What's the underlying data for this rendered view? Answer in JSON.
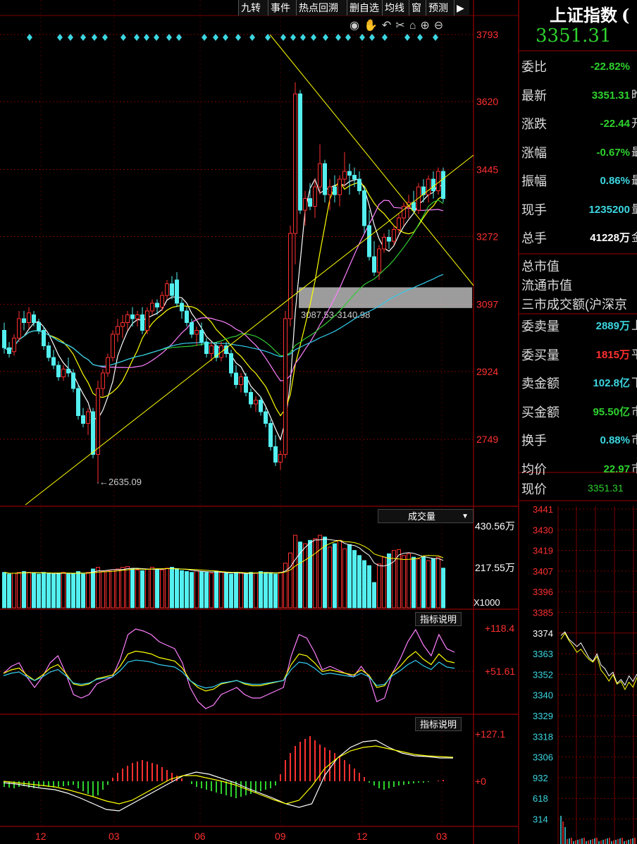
{
  "toolbar": {
    "buttons": [
      "九转",
      "事件",
      "热点回溯",
      "删自选",
      "均线",
      "窗",
      "预测"
    ]
  },
  "main_chart": {
    "y_ticks": [
      "3793",
      "3620",
      "3445",
      "3272",
      "3097",
      "2924",
      "2749"
    ],
    "low_annotation": "2635.09",
    "zone_annotation": "3087.53-3140.98",
    "x_ticks": [
      "12",
      "03",
      "06",
      "09",
      "12",
      "03"
    ]
  },
  "volume_panel": {
    "selector_label": "成交量",
    "ticks": [
      "430.56万",
      "217.55万"
    ],
    "unit": "X1000"
  },
  "indicator_1": {
    "label": "指标说明",
    "ticks": [
      "+118.4",
      "+51.61"
    ]
  },
  "indicator_2": {
    "label": "指标说明",
    "ticks": [
      "+127.1",
      "+0"
    ]
  },
  "quote": {
    "title": "上证指数",
    "title_tail": "(",
    "price": "3351.31",
    "rows": [
      {
        "label": "委比",
        "value": "-22.82%",
        "color": "green",
        "tail": ""
      },
      {
        "label": "最新",
        "value": "3351.31",
        "color": "green",
        "tail": "昨"
      },
      {
        "label": "涨跌",
        "value": "-22.44",
        "color": "green",
        "tail": "开"
      },
      {
        "label": "涨幅",
        "value": "-0.67%",
        "color": "green",
        "tail": "最"
      },
      {
        "label": "振幅",
        "value": "0.86%",
        "color": "cyan",
        "tail": "最"
      },
      {
        "label": "现手",
        "value": "1235200",
        "color": "cyan",
        "tail": "量"
      },
      {
        "label": "总手",
        "value": "41228万",
        "color": "white",
        "tail": "金"
      }
    ],
    "market_labels": [
      "总市值",
      "流通市值",
      "三市成交额(沪深京"
    ],
    "rows2": [
      {
        "label": "委卖量",
        "value": "2889万",
        "color": "cyan",
        "tail": "上"
      },
      {
        "label": "委买量",
        "value": "1815万",
        "color": "red",
        "tail": "平"
      },
      {
        "label": "卖金额",
        "value": "102.8亿",
        "color": "cyan",
        "tail": "下"
      },
      {
        "label": "买金额",
        "value": "95.50亿",
        "color": "green",
        "tail": "市"
      },
      {
        "label": "换手",
        "value": "0.88%",
        "color": "cyan",
        "tail": "市"
      },
      {
        "label": "均价",
        "value": "22.97",
        "color": "green",
        "tail": "市"
      }
    ],
    "current_label": "现价",
    "current_value": "3351.31"
  },
  "intraday": {
    "ticks": [
      "3441",
      "3430",
      "3419",
      "3407",
      "3396",
      "3385",
      "3374",
      "3363",
      "3352",
      "3340",
      "3329",
      "3318",
      "3306",
      "932",
      "618",
      "314"
    ]
  },
  "colors": {
    "up": "#ff3030",
    "down": "#54f0f0",
    "ma5": "#ffffff",
    "ma10": "#ffff00",
    "ma20": "#ff80ff",
    "ma30": "#33cc33",
    "ma60": "#33ccee",
    "grid": "#7a0000",
    "axis_text": "#ff3030"
  },
  "chart_data": {
    "type": "candlestick",
    "y_ticks": [
      2749,
      2924,
      3097,
      3272,
      3445,
      3620,
      3793
    ],
    "ylim": [
      2585,
      3850
    ],
    "x_tick_labels": [
      "12",
      "03",
      "06",
      "09",
      "12",
      "03"
    ],
    "period_low": 2635.09,
    "zone": [
      3087.53,
      3140.98
    ],
    "candles": [
      [
        3030,
        3050,
        2970,
        2985
      ],
      [
        2985,
        3000,
        2960,
        2970
      ],
      [
        2975,
        3020,
        2965,
        3010
      ],
      [
        3010,
        3080,
        3000,
        3060
      ],
      [
        3060,
        3080,
        3030,
        3050
      ],
      [
        3050,
        3090,
        3035,
        3075
      ],
      [
        3070,
        3080,
        3040,
        3050
      ],
      [
        3050,
        3060,
        3020,
        3030
      ],
      [
        3030,
        3040,
        2980,
        2990
      ],
      [
        2990,
        3000,
        2950,
        2960
      ],
      [
        2960,
        2980,
        2930,
        2940
      ],
      [
        2940,
        2950,
        2900,
        2910
      ],
      [
        2910,
        2940,
        2900,
        2930
      ],
      [
        2930,
        2960,
        2910,
        2920
      ],
      [
        2920,
        2930,
        2870,
        2880
      ],
      [
        2880,
        2890,
        2800,
        2810
      ],
      [
        2810,
        2830,
        2780,
        2790
      ],
      [
        2790,
        2830,
        2760,
        2820
      ],
      [
        2820,
        2830,
        2700,
        2710
      ],
      [
        2710,
        2900,
        2635,
        2880
      ],
      [
        2880,
        2930,
        2860,
        2920
      ],
      [
        2920,
        2970,
        2910,
        2960
      ],
      [
        2960,
        3030,
        2950,
        3020
      ],
      [
        3020,
        3060,
        3000,
        3040
      ],
      [
        3040,
        3070,
        3010,
        3050
      ],
      [
        3050,
        3080,
        3030,
        3070
      ],
      [
        3070,
        3090,
        3040,
        3060
      ],
      [
        3060,
        3080,
        3040,
        3070
      ],
      [
        3070,
        3090,
        3020,
        3030
      ],
      [
        3030,
        3090,
        3020,
        3080
      ],
      [
        3080,
        3110,
        3070,
        3100
      ],
      [
        3100,
        3110,
        3070,
        3090
      ],
      [
        3090,
        3130,
        3080,
        3120
      ],
      [
        3120,
        3160,
        3110,
        3150
      ],
      [
        3150,
        3170,
        3110,
        3120
      ],
      [
        3160,
        3180,
        3090,
        3100
      ],
      [
        3100,
        3110,
        3060,
        3080
      ],
      [
        3080,
        3090,
        3040,
        3050
      ],
      [
        3050,
        3060,
        3010,
        3020
      ],
      [
        3020,
        3040,
        2990,
        3030
      ],
      [
        3030,
        3050,
        2990,
        3000
      ],
      [
        3000,
        3010,
        2960,
        2970
      ],
      [
        2970,
        3000,
        2950,
        2990
      ],
      [
        2990,
        3000,
        2950,
        2960
      ],
      [
        2960,
        3000,
        2950,
        2990
      ],
      [
        2990,
        3000,
        2960,
        2970
      ],
      [
        2970,
        2980,
        2910,
        2920
      ],
      [
        2920,
        2940,
        2880,
        2890
      ],
      [
        2890,
        2920,
        2870,
        2910
      ],
      [
        2910,
        2920,
        2860,
        2870
      ],
      [
        2870,
        2880,
        2830,
        2840
      ],
      [
        2840,
        2860,
        2820,
        2850
      ],
      [
        2850,
        2860,
        2810,
        2820
      ],
      [
        2820,
        2830,
        2780,
        2790
      ],
      [
        2790,
        2800,
        2720,
        2730
      ],
      [
        2730,
        2760,
        2680,
        2690
      ],
      [
        2690,
        2720,
        2670,
        2710
      ],
      [
        2710,
        3080,
        2700,
        3060
      ],
      [
        3060,
        3300,
        3040,
        3280
      ],
      [
        3280,
        3670,
        3200,
        3640
      ],
      [
        3640,
        3650,
        3330,
        3340
      ],
      [
        3340,
        3390,
        3300,
        3370
      ],
      [
        3370,
        3410,
        3340,
        3350
      ],
      [
        3350,
        3420,
        3320,
        3400
      ],
      [
        3400,
        3510,
        3380,
        3460
      ],
      [
        3460,
        3470,
        3360,
        3380
      ],
      [
        3380,
        3420,
        3340,
        3400
      ],
      [
        3400,
        3430,
        3360,
        3380
      ],
      [
        3380,
        3430,
        3350,
        3420
      ],
      [
        3420,
        3490,
        3400,
        3440
      ],
      [
        3440,
        3460,
        3380,
        3430
      ],
      [
        3430,
        3450,
        3400,
        3420
      ],
      [
        3420,
        3440,
        3380,
        3390
      ],
      [
        3390,
        3400,
        3280,
        3300
      ],
      [
        3300,
        3340,
        3210,
        3220
      ],
      [
        3220,
        3260,
        3170,
        3180
      ],
      [
        3180,
        3250,
        3160,
        3240
      ],
      [
        3240,
        3280,
        3230,
        3270
      ],
      [
        3270,
        3290,
        3240,
        3260
      ],
      [
        3260,
        3300,
        3250,
        3290
      ],
      [
        3290,
        3330,
        3280,
        3320
      ],
      [
        3320,
        3360,
        3300,
        3350
      ],
      [
        3350,
        3380,
        3320,
        3360
      ],
      [
        3360,
        3390,
        3330,
        3340
      ],
      [
        3340,
        3410,
        3330,
        3400
      ],
      [
        3400,
        3420,
        3360,
        3380
      ],
      [
        3380,
        3430,
        3360,
        3420
      ],
      [
        3420,
        3440,
        3370,
        3390
      ],
      [
        3390,
        3450,
        3380,
        3440
      ],
      [
        3440,
        3450,
        3360,
        3370
      ]
    ],
    "volume": [
      210,
      200,
      205,
      210,
      215,
      210,
      205,
      200,
      210,
      205,
      200,
      205,
      210,
      200,
      205,
      215,
      200,
      210,
      230,
      240,
      215,
      220,
      225,
      230,
      240,
      245,
      230,
      225,
      220,
      230,
      240,
      230,
      225,
      235,
      240,
      230,
      220,
      215,
      210,
      220,
      215,
      210,
      205,
      215,
      210,
      205,
      200,
      210,
      205,
      200,
      210,
      205,
      215,
      210,
      205,
      200,
      210,
      265,
      325,
      430,
      390,
      380,
      400,
      410,
      430,
      420,
      360,
      380,
      400,
      350,
      375,
      340,
      310,
      280,
      250,
      150,
      260,
      300,
      320,
      340,
      345,
      310,
      320,
      300,
      290,
      300,
      280,
      290,
      300,
      235
    ]
  },
  "intraday_series": [
    3372,
    3374,
    3370,
    3368,
    3366,
    3368,
    3364,
    3360,
    3358,
    3362,
    3356,
    3354,
    3350,
    3352,
    3346,
    3348,
    3345,
    3350,
    3347,
    3351
  ]
}
